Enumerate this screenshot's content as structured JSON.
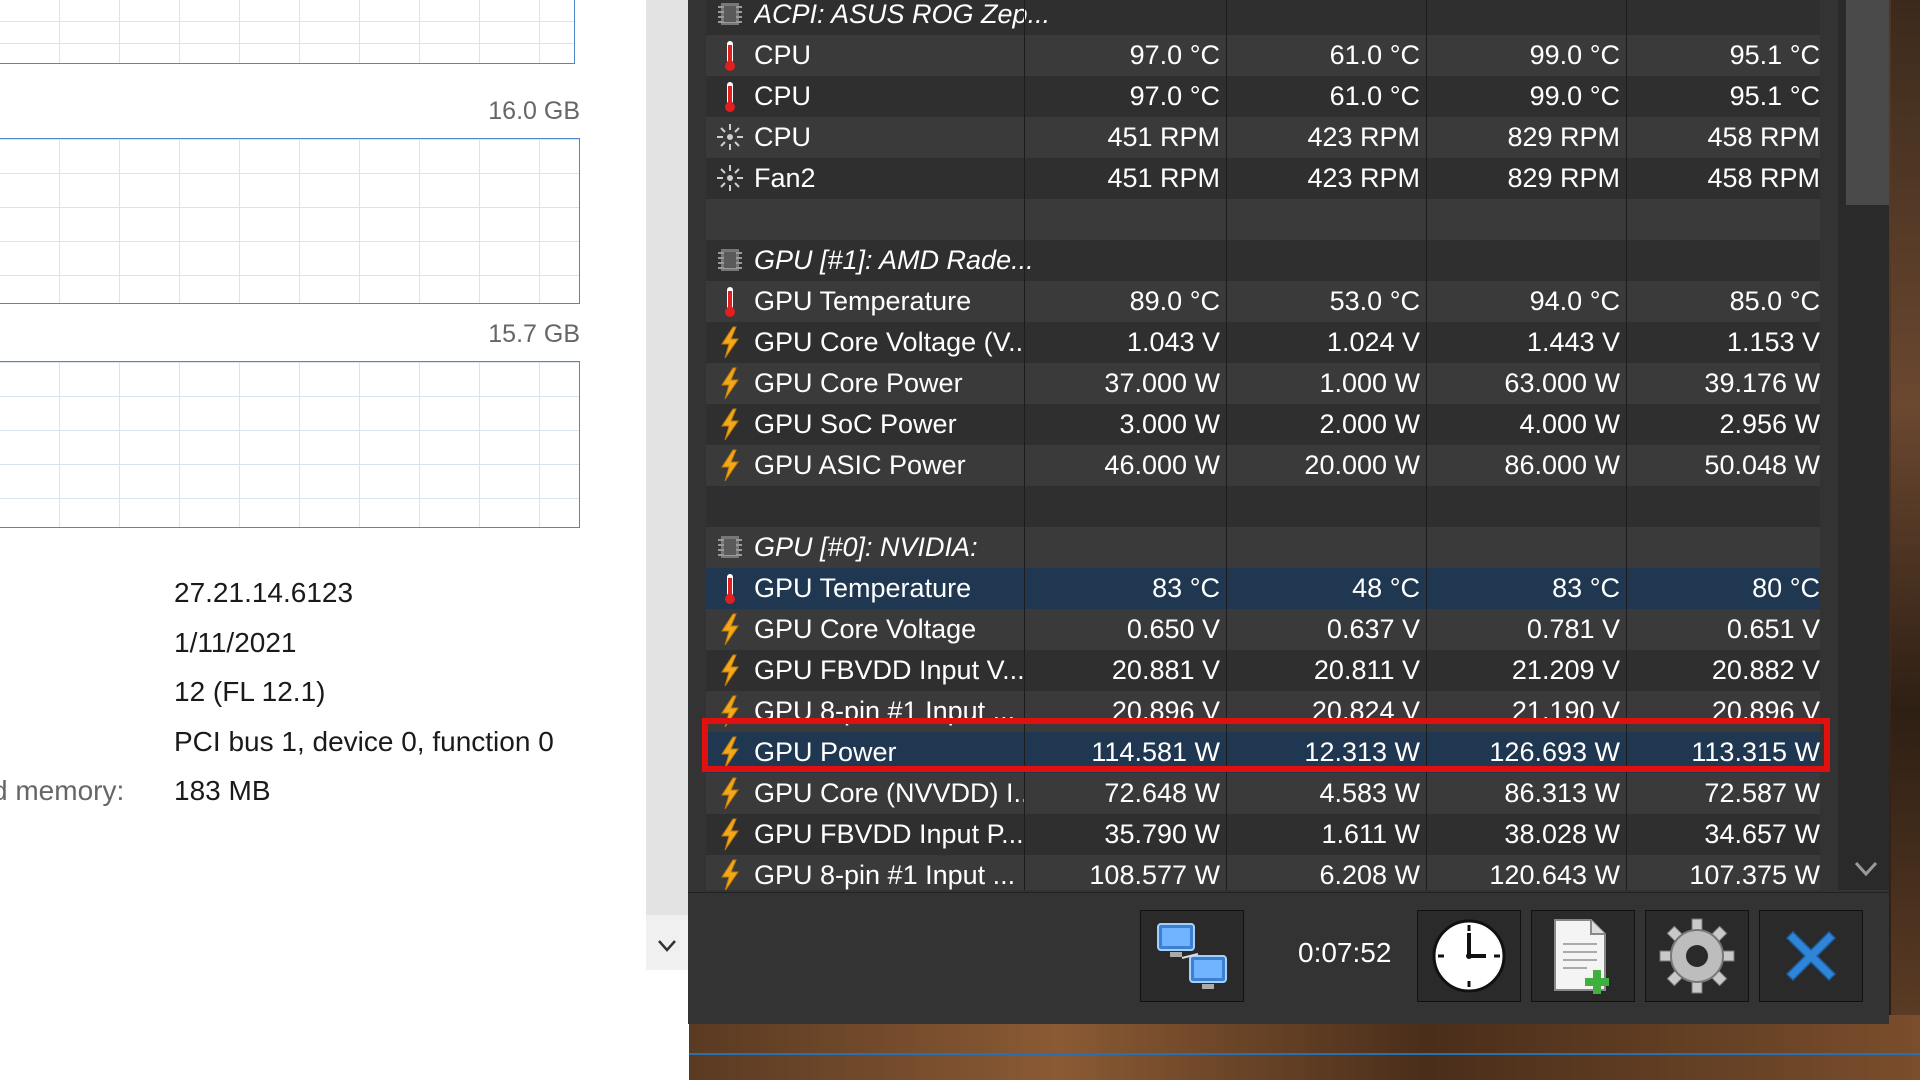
{
  "task_manager": {
    "graph_2_max": "16.0 GB",
    "graph_3_max": "15.7 GB",
    "details": [
      {
        "label": "",
        "value": "27.21.14.6123"
      },
      {
        "label": "",
        "value": "1/11/2021"
      },
      {
        "label": "",
        "value": "12 (FL 12.1)"
      },
      {
        "label": "",
        "value": "PCI bus 1, device 0, function 0"
      },
      {
        "label": "d memory:",
        "value": "183 MB"
      }
    ]
  },
  "hwinfo": {
    "rows": [
      {
        "type": "group",
        "name": "ACPI: ASUS ROG Zep...",
        "icon": "chip-icon"
      },
      {
        "type": "sensor",
        "icon": "thermometer-icon",
        "name": "CPU",
        "current": "97.0 °C",
        "min": "61.0 °C",
        "max": "99.0 °C",
        "avg": "95.1 °C"
      },
      {
        "type": "sensor",
        "icon": "thermometer-icon",
        "name": "CPU",
        "current": "97.0 °C",
        "min": "61.0 °C",
        "max": "99.0 °C",
        "avg": "95.1 °C"
      },
      {
        "type": "sensor",
        "icon": "fan-icon",
        "name": "CPU",
        "current": "451 RPM",
        "min": "423 RPM",
        "max": "829 RPM",
        "avg": "458 RPM"
      },
      {
        "type": "sensor",
        "icon": "fan-icon",
        "name": "Fan2",
        "current": "451 RPM",
        "min": "423 RPM",
        "max": "829 RPM",
        "avg": "458 RPM"
      },
      {
        "type": "empty"
      },
      {
        "type": "group",
        "name": "GPU [#1]: AMD Rade...",
        "icon": "chip-icon"
      },
      {
        "type": "sensor",
        "icon": "thermometer-icon",
        "name": "GPU Temperature",
        "current": "89.0 °C",
        "min": "53.0 °C",
        "max": "94.0 °C",
        "avg": "85.0 °C"
      },
      {
        "type": "sensor",
        "icon": "lightning-icon",
        "name": "GPU Core Voltage (V...",
        "current": "1.043 V",
        "min": "1.024 V",
        "max": "1.443 V",
        "avg": "1.153 V"
      },
      {
        "type": "sensor",
        "icon": "lightning-icon",
        "name": "GPU Core Power",
        "current": "37.000 W",
        "min": "1.000 W",
        "max": "63.000 W",
        "avg": "39.176 W"
      },
      {
        "type": "sensor",
        "icon": "lightning-icon",
        "name": "GPU SoC Power",
        "current": "3.000 W",
        "min": "2.000 W",
        "max": "4.000 W",
        "avg": "2.956 W"
      },
      {
        "type": "sensor",
        "icon": "lightning-icon",
        "name": "GPU ASIC Power",
        "current": "46.000 W",
        "min": "20.000 W",
        "max": "86.000 W",
        "avg": "50.048 W"
      },
      {
        "type": "empty"
      },
      {
        "type": "group",
        "name": "GPU [#0]: NVIDIA:",
        "icon": "chip-icon"
      },
      {
        "type": "sensor",
        "icon": "thermometer-icon",
        "name": "GPU Temperature",
        "current": "83 °C",
        "min": "48 °C",
        "max": "83 °C",
        "avg": "80 °C",
        "selected": true
      },
      {
        "type": "sensor",
        "icon": "lightning-icon",
        "name": "GPU Core Voltage",
        "current": "0.650 V",
        "min": "0.637 V",
        "max": "0.781 V",
        "avg": "0.651 V"
      },
      {
        "type": "sensor",
        "icon": "lightning-icon",
        "name": "GPU FBVDD Input V...",
        "current": "20.881 V",
        "min": "20.811 V",
        "max": "21.209 V",
        "avg": "20.882 V"
      },
      {
        "type": "sensor",
        "icon": "lightning-icon",
        "name": "GPU 8-pin #1 Input ...",
        "current": "20.896 V",
        "min": "20.824 V",
        "max": "21.190 V",
        "avg": "20.896 V"
      },
      {
        "type": "sensor",
        "icon": "lightning-icon",
        "name": "GPU Power",
        "current": "114.581 W",
        "min": "12.313 W",
        "max": "126.693 W",
        "avg": "113.315 W",
        "selected": true,
        "highlighted": true
      },
      {
        "type": "sensor",
        "icon": "lightning-icon",
        "name": "GPU Core (NVVDD) I...",
        "current": "72.648 W",
        "min": "4.583 W",
        "max": "86.313 W",
        "avg": "72.587 W"
      },
      {
        "type": "sensor",
        "icon": "lightning-icon",
        "name": "GPU FBVDD Input P...",
        "current": "35.790 W",
        "min": "1.611 W",
        "max": "38.028 W",
        "avg": "34.657 W"
      },
      {
        "type": "sensor",
        "icon": "lightning-icon",
        "name": "GPU 8-pin #1 Input ...",
        "current": "108.577 W",
        "min": "6.208 W",
        "max": "120.643 W",
        "avg": "107.375 W"
      }
    ],
    "toolbar": {
      "timer": "0:07:52",
      "buttons": [
        "network-icon",
        "clock-icon",
        "report-icon",
        "settings-icon",
        "close-icon"
      ]
    },
    "colors": {
      "highlight": "#e01010",
      "selected_row": "#1f3750",
      "lightning": "#f2a81d",
      "thermometer": "#e02020",
      "close_x": "#2f86d8"
    }
  }
}
